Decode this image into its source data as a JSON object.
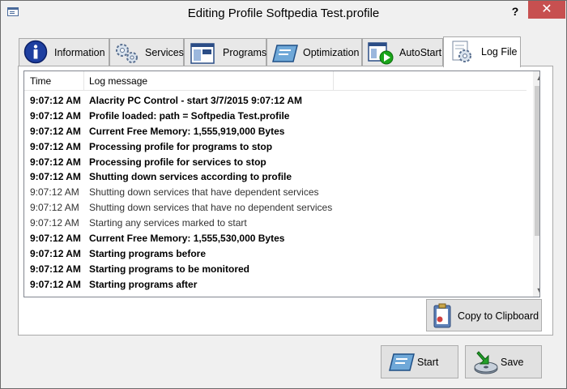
{
  "window": {
    "title": "Editing Profile Softpedia Test.profile",
    "help_label": "?",
    "close_label": "✕"
  },
  "tabs": [
    {
      "label": "Information",
      "icon": "info-icon"
    },
    {
      "label": "Services",
      "icon": "gears-icon"
    },
    {
      "label": "Programs",
      "icon": "window-icon"
    },
    {
      "label": "Optimization",
      "icon": "optimization-icon"
    },
    {
      "label": "AutoStart",
      "icon": "autostart-icon"
    },
    {
      "label": "Log File",
      "icon": "log-gear-icon",
      "active": true
    }
  ],
  "log": {
    "columns": [
      "Time",
      "Log message"
    ],
    "rows": [
      {
        "time": "9:07:12 AM",
        "message": "Alacrity PC Control - start 3/7/2015 9:07:12 AM",
        "bold": true
      },
      {
        "time": "9:07:12 AM",
        "message": "Profile loaded:  path = Softpedia Test.profile",
        "bold": true
      },
      {
        "time": "9:07:12 AM",
        "message": "Current Free Memory: 1,555,919,000 Bytes",
        "bold": true
      },
      {
        "time": "9:07:12 AM",
        "message": "Processing profile for programs to stop",
        "bold": true
      },
      {
        "time": "9:07:12 AM",
        "message": "Processing profile for services to stop",
        "bold": true
      },
      {
        "time": "9:07:12 AM",
        "message": "Shutting down services according to profile",
        "bold": true
      },
      {
        "time": "9:07:12 AM",
        "message": "Shutting down services that have dependent services",
        "bold": false
      },
      {
        "time": "9:07:12 AM",
        "message": "Shutting down services that have no dependent services",
        "bold": false
      },
      {
        "time": "9:07:12 AM",
        "message": "Starting any services marked to start",
        "bold": false
      },
      {
        "time": "9:07:12 AM",
        "message": "Current Free Memory: 1,555,530,000 Bytes",
        "bold": true
      },
      {
        "time": "9:07:12 AM",
        "message": "Starting programs before",
        "bold": true
      },
      {
        "time": "9:07:12 AM",
        "message": "Starting programs to be monitored",
        "bold": true
      },
      {
        "time": "9:07:12 AM",
        "message": "Starting programs after",
        "bold": true
      }
    ]
  },
  "buttons": {
    "copy_clipboard": "Copy to Clipboard",
    "start": "Start",
    "save": "Save"
  },
  "colors": {
    "close_button": "#c75050",
    "info_icon": "#1e3fa0",
    "autostart_arrow": "#1aa51a"
  }
}
